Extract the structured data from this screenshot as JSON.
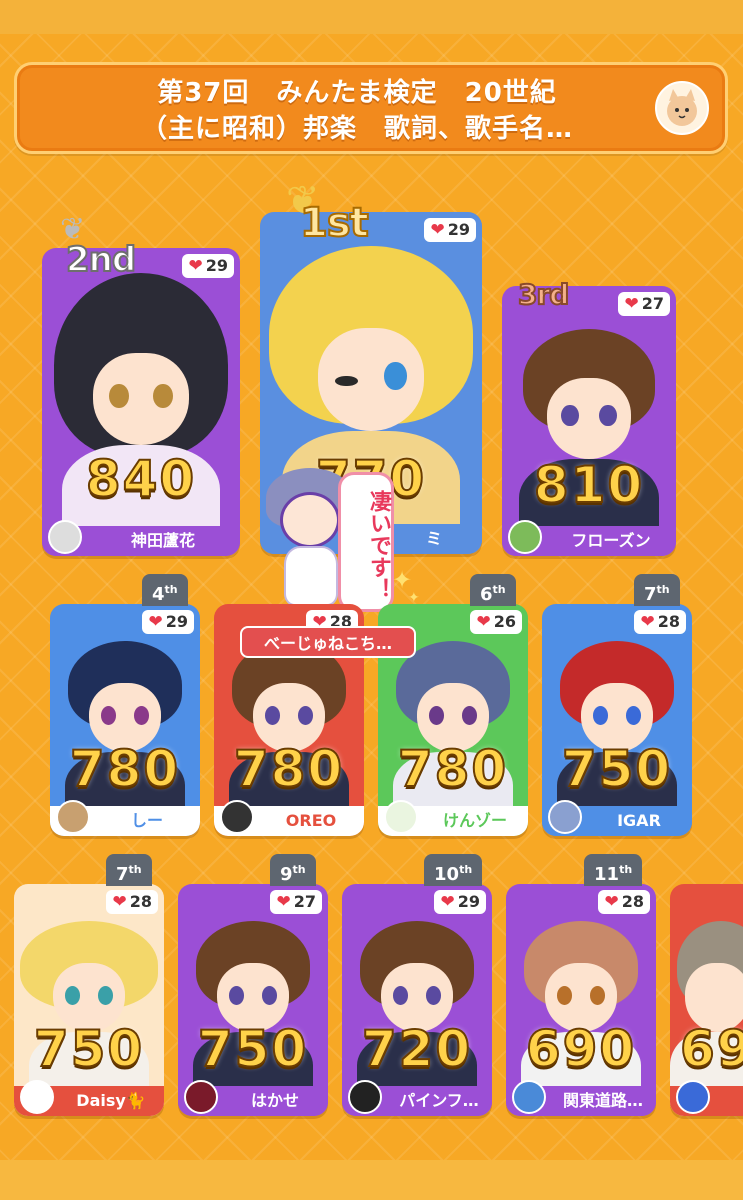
{
  "header": {
    "title": "第37回　みんたま検定　20世紀\n（主に昭和）邦楽　歌詞、歌手名…"
  },
  "speech_bubble": "凄いです！",
  "current_player": "べーじゅねこち…",
  "medals": {
    "first": "1st",
    "second": "2nd",
    "third": "3rd"
  },
  "podium": [
    {
      "rank": "1st",
      "score": "770",
      "likes": "29",
      "name": "ミ",
      "color": "#5a8fe0",
      "hair": "#f3d24e"
    },
    {
      "rank": "2nd",
      "score": "840",
      "likes": "29",
      "name": "神田蘆花",
      "color": "#9b4fd6",
      "hair": "#2b2b36"
    },
    {
      "rank": "3rd",
      "score": "810",
      "likes": "27",
      "name": "フローズン",
      "color": "#9b4fd6",
      "hair": "#6b4225"
    }
  ],
  "row2": [
    {
      "rank": "4",
      "suffix": "th",
      "score": "780",
      "likes": "29",
      "name": "しー",
      "color": "#4f8fe6",
      "hair": "#1f2f5a"
    },
    {
      "rank": "",
      "suffix": "",
      "score": "780",
      "likes": "28",
      "name": "OREO",
      "color": "#e5503e",
      "hair": "#6b4225"
    },
    {
      "rank": "6",
      "suffix": "th",
      "score": "780",
      "likes": "26",
      "name": "けんゾー",
      "color": "#5cc85a",
      "hair": "#5a6a9a"
    },
    {
      "rank": "7",
      "suffix": "th",
      "score": "750",
      "likes": "28",
      "name": "IGAR",
      "color": "#4f8fe6",
      "hair": "#c42a2a"
    }
  ],
  "row3": [
    {
      "rank": "7",
      "suffix": "th",
      "score": "750",
      "likes": "28",
      "name": "Daisy🐈",
      "color": "#e5503e",
      "hair": "#f3d76a"
    },
    {
      "rank": "9",
      "suffix": "th",
      "score": "750",
      "likes": "27",
      "name": "はかせ",
      "color": "#9b4fd6",
      "hair": "#6b4225"
    },
    {
      "rank": "10",
      "suffix": "th",
      "score": "720",
      "likes": "29",
      "name": "パインフ…",
      "color": "#9b4fd6",
      "hair": "#6b4225"
    },
    {
      "rank": "11",
      "suffix": "th",
      "score": "690",
      "likes": "28",
      "name": "関東道路…",
      "color": "#9b4fd6",
      "hair": "#c8896a"
    },
    {
      "rank": "",
      "suffix": "",
      "score": "69",
      "likes": "",
      "name": "",
      "color": "#e5503e",
      "hair": "#9a9080"
    }
  ],
  "colors": {
    "background": "#f7a825",
    "header": "#f28a1d",
    "purple_card": "#9b4fd6",
    "blue_card": "#4f8fe6",
    "red_card": "#e5503e",
    "green_card": "#5cc85a"
  }
}
